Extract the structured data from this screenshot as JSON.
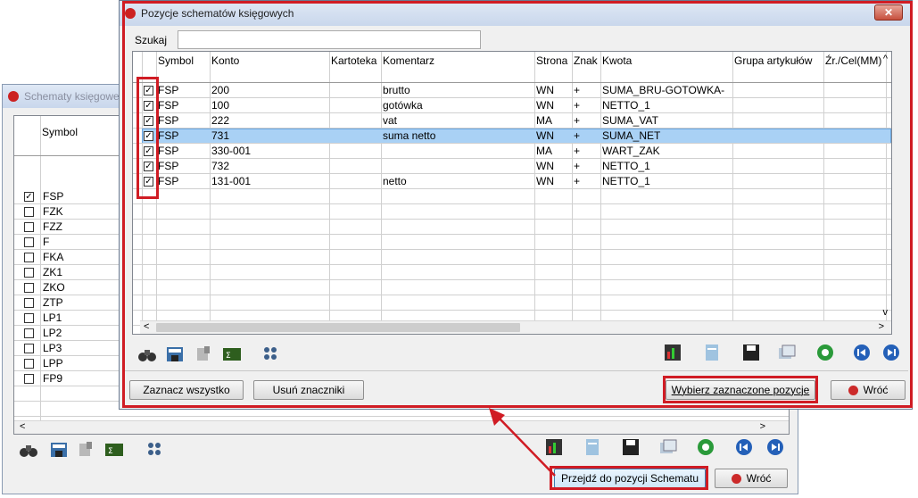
{
  "back": {
    "title": "Schematy księgowe",
    "col_symbol": "Symbol",
    "rows": [
      {
        "checked": true,
        "symbol": "FSP"
      },
      {
        "checked": false,
        "symbol": "FZK"
      },
      {
        "checked": false,
        "symbol": "FZZ"
      },
      {
        "checked": false,
        "symbol": "F"
      },
      {
        "checked": false,
        "symbol": "FKA"
      },
      {
        "checked": false,
        "symbol": "ZK1"
      },
      {
        "checked": false,
        "symbol": "ZKO"
      },
      {
        "checked": false,
        "symbol": "ZTP"
      },
      {
        "checked": false,
        "symbol": "LP1"
      },
      {
        "checked": false,
        "symbol": "LP2"
      },
      {
        "checked": false,
        "symbol": "LP3"
      },
      {
        "checked": false,
        "symbol": "LPP"
      },
      {
        "checked": false,
        "symbol": "FP9"
      }
    ],
    "goto_label": "Przejdź do pozycji Schematu",
    "back_label": "Wróć"
  },
  "front": {
    "title": "Pozycje schematów księgowych",
    "search_label": "Szukaj",
    "search_value": "",
    "columns": [
      "Symbol",
      "Konto",
      "Kartoteka",
      "Komentarz",
      "Strona",
      "Znak",
      "Kwota",
      "Grupa artykułów",
      "Źr./Cel(MM)"
    ],
    "rows": [
      {
        "checked": true,
        "symbol": "FSP",
        "konto": "200",
        "kartoteka": "",
        "komentarz": "brutto",
        "strona": "WN",
        "znak": "+",
        "kwota": "SUMA_BRU-GOTOWKA-"
      },
      {
        "checked": true,
        "symbol": "FSP",
        "konto": "100",
        "kartoteka": "",
        "komentarz": "gotówka",
        "strona": "WN",
        "znak": "+",
        "kwota": "NETTO_1"
      },
      {
        "checked": true,
        "symbol": "FSP",
        "konto": "222",
        "kartoteka": "",
        "komentarz": "vat",
        "strona": "MA",
        "znak": "+",
        "kwota": "SUMA_VAT"
      },
      {
        "checked": true,
        "symbol": "FSP",
        "konto": "731",
        "kartoteka": "",
        "komentarz": "suma netto",
        "strona": "WN",
        "znak": "+",
        "kwota": "SUMA_NET"
      },
      {
        "checked": true,
        "symbol": "FSP",
        "konto": "330-001",
        "kartoteka": "",
        "komentarz": "",
        "strona": "MA",
        "znak": "+",
        "kwota": "WART_ZAK"
      },
      {
        "checked": true,
        "symbol": "FSP",
        "konto": "732",
        "kartoteka": "",
        "komentarz": "",
        "strona": "WN",
        "znak": "+",
        "kwota": "NETTO_1"
      },
      {
        "checked": true,
        "symbol": "FSP",
        "konto": "131-001",
        "kartoteka": "",
        "komentarz": "netto",
        "strona": "WN",
        "znak": "+",
        "kwota": "NETTO_1"
      }
    ],
    "select_all_label": "Zaznacz wszystko",
    "clear_marks_label": "Usuń znaczniki",
    "pick_selected_label": "Wybierz zaznaczone pozycje",
    "back_label": "Wróć"
  },
  "colors": {
    "highlight": "#d01c24",
    "selected_row": "#a9d1f5"
  }
}
